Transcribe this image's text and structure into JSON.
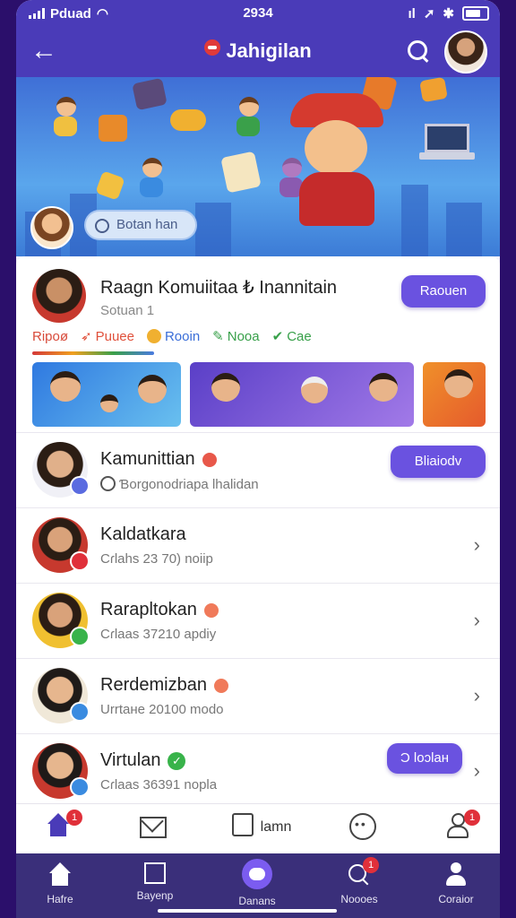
{
  "status_bar": {
    "carrier": "Pduad",
    "time": "2934"
  },
  "header": {
    "title": "Jahigilan"
  },
  "banner": {
    "search_placeholder": "Botan han"
  },
  "featured": {
    "title": "Raagn Komuiitaa ₺ Inannitain",
    "subtitle": "Sotuan  1",
    "button_label": "Raouen",
    "chips": [
      {
        "label": "Ripoø",
        "color": "#d84a3a"
      },
      {
        "label": "Puuee",
        "color": "#e0503a"
      },
      {
        "label": "Rooin",
        "color": "#3a6ed8"
      },
      {
        "label": "Noоa",
        "color": "#38a04a"
      },
      {
        "label": "Cae",
        "color": "#38a04a"
      }
    ]
  },
  "list": [
    {
      "name": "Kamunittian",
      "meta": "Ɓorgonodriapa  Ɩhalidan",
      "action": "Bliaiodv",
      "icon": "heart-icon",
      "badge_color": "#5a6be0"
    },
    {
      "name": "Kaldatkara",
      "meta": "Cɾlahs  23 70) noiip",
      "icon": "",
      "badge_color": "#e0303a"
    },
    {
      "name": "Rarapltokan",
      "meta": "Cɾlaas  37210 apdiy",
      "icon": "heart-icon",
      "badge_color": "#38b34a"
    },
    {
      "name": "Rerdemizban",
      "meta": "Urrtaнe  20100 modo",
      "icon": "heart-icon",
      "badge_color": "#3a8be0"
    },
    {
      "name": "Virtulan",
      "meta": "Cɾlaas  36391 nopla",
      "action": "Ɔ loɔlaн",
      "icon": "verified-icon",
      "badge_color": "#3a8be0"
    }
  ],
  "tabbar": {
    "notif_home": "1",
    "notif_profile": "1",
    "middle_label": "lamn"
  },
  "bottom_nav": [
    {
      "label": "Hafre"
    },
    {
      "label": "Bayenp"
    },
    {
      "label": "Danans"
    },
    {
      "label": "Noooes",
      "badge": "1"
    },
    {
      "label": "Coraior"
    }
  ],
  "colors": {
    "accent": "#6a52e0",
    "header": "#4a3bb8",
    "nav": "#3a2f7a"
  }
}
